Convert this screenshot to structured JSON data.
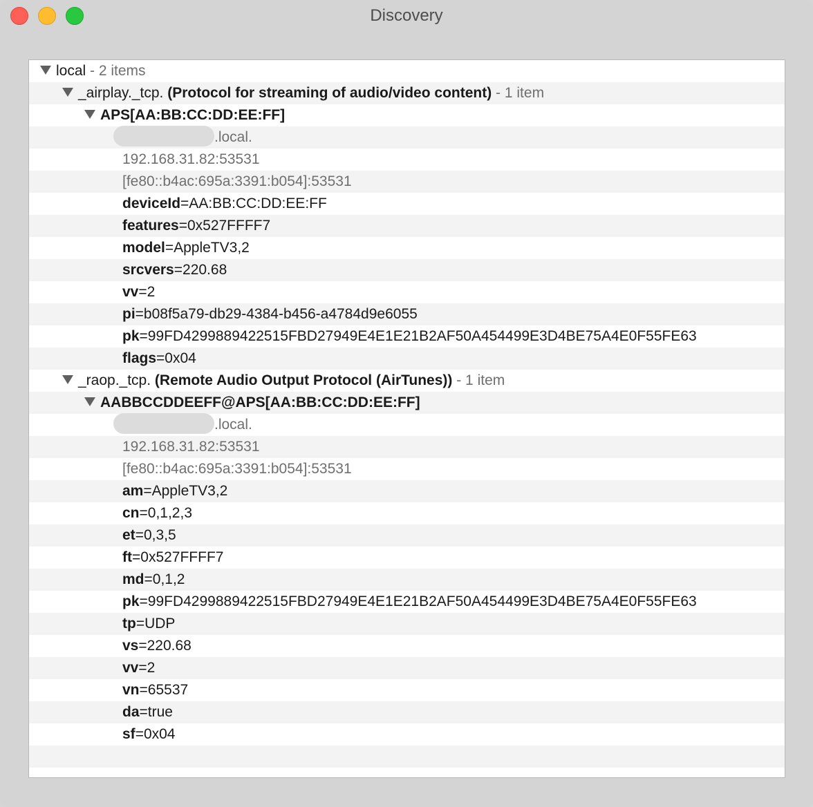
{
  "window": {
    "title": "Discovery"
  },
  "tree": {
    "root": {
      "name": "local",
      "summary": " - 2 items"
    },
    "services": [
      {
        "type": "_airplay._tcp.",
        "description": "(Protocol for streaming of audio/video content)",
        "summary": " - 1 item",
        "instance": {
          "name": "APS[AA:BB:CC:DD:EE:FF]",
          "host_suffix": ".local.",
          "ipv4": "192.168.31.82:53531",
          "ipv6": "[fe80::b4ac:695a:3391:b054]:53531",
          "records": [
            {
              "key": "deviceId",
              "value": "=AA:BB:CC:DD:EE:FF"
            },
            {
              "key": "features",
              "value": "=0x527FFFF7"
            },
            {
              "key": "model",
              "value": "=AppleTV3,2"
            },
            {
              "key": "srcvers",
              "value": "=220.68"
            },
            {
              "key": "vv",
              "value": "=2"
            },
            {
              "key": "pi",
              "value": "=b08f5a79-db29-4384-b456-a4784d9e6055"
            },
            {
              "key": "pk",
              "value": "=99FD4299889422515FBD27949E4E1E21B2AF50A454499E3D4BE75A4E0F55FE63"
            },
            {
              "key": "flags",
              "value": "=0x04"
            }
          ]
        }
      },
      {
        "type": "_raop._tcp.",
        "description": "(Remote Audio Output Protocol (AirTunes))",
        "summary": " - 1 item",
        "instance": {
          "name": "AABBCCDDEEFF@APS[AA:BB:CC:DD:EE:FF]",
          "host_suffix": ".local.",
          "ipv4": "192.168.31.82:53531",
          "ipv6": "[fe80::b4ac:695a:3391:b054]:53531",
          "records": [
            {
              "key": "am",
              "value": "=AppleTV3,2"
            },
            {
              "key": "cn",
              "value": "=0,1,2,3"
            },
            {
              "key": "et",
              "value": "=0,3,5"
            },
            {
              "key": "ft",
              "value": "=0x527FFFF7"
            },
            {
              "key": "md",
              "value": "=0,1,2"
            },
            {
              "key": "pk",
              "value": "=99FD4299889422515FBD27949E4E1E21B2AF50A454499E3D4BE75A4E0F55FE63"
            },
            {
              "key": "tp",
              "value": "=UDP"
            },
            {
              "key": "vs",
              "value": "=220.68"
            },
            {
              "key": "vv",
              "value": "=2"
            },
            {
              "key": "vn",
              "value": "=65537"
            },
            {
              "key": "da",
              "value": "=true"
            },
            {
              "key": "sf",
              "value": "=0x04"
            }
          ]
        }
      }
    ]
  }
}
